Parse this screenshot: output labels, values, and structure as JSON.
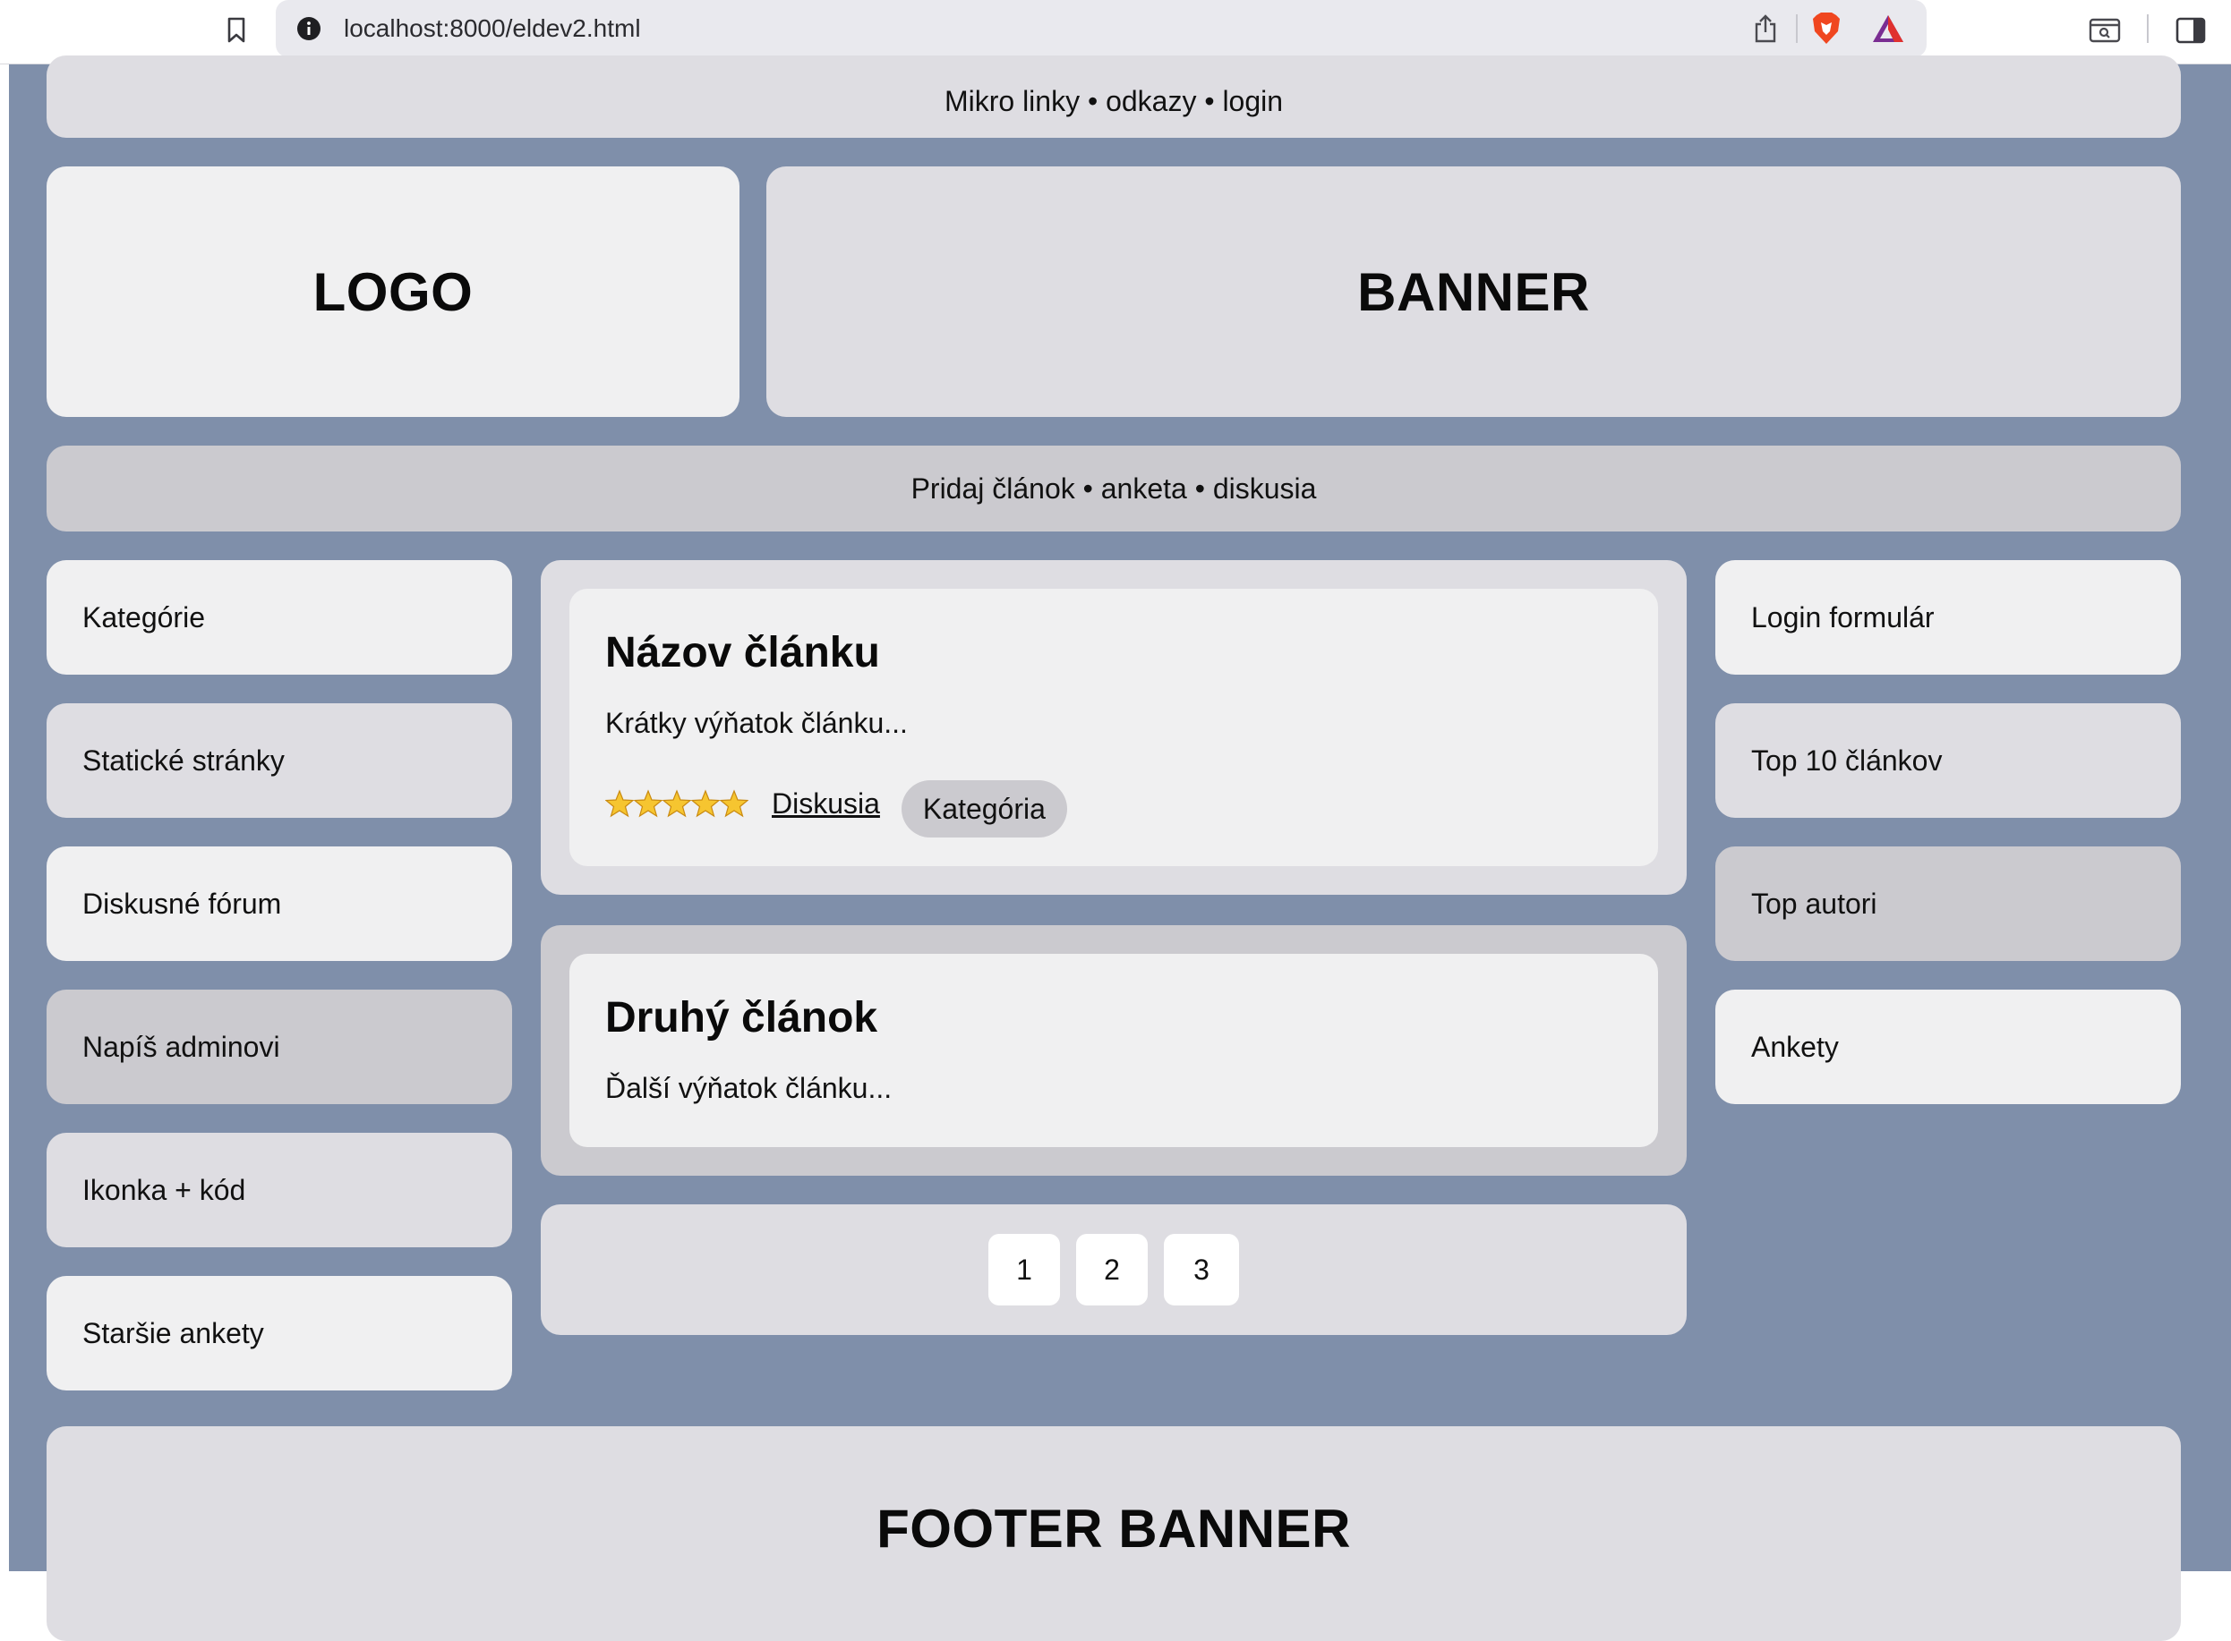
{
  "browser": {
    "url": "localhost:8000/eldev2.html"
  },
  "header": {
    "micro_links": "Mikro linky • odkazy • login",
    "logo": "LOGO",
    "banner": "BANNER",
    "action_bar": "Pridaj článok • anketa • diskusia"
  },
  "left_sidebar": {
    "items": [
      {
        "label": "Kategórie"
      },
      {
        "label": "Statické stránky"
      },
      {
        "label": "Diskusné fórum"
      },
      {
        "label": "Napíš adminovi"
      },
      {
        "label": "Ikonka + kód"
      },
      {
        "label": "Staršie ankety"
      }
    ]
  },
  "articles": [
    {
      "title": "Názov článku",
      "excerpt": "Krátky výňatok článku...",
      "rating_stars": 5,
      "discussion_link": "Diskusia",
      "category_badge": "Kategória"
    },
    {
      "title": "Druhý článok",
      "excerpt": "Ďalší výňatok článku..."
    }
  ],
  "pagination": {
    "pages": [
      "1",
      "2",
      "3"
    ]
  },
  "right_sidebar": {
    "items": [
      {
        "label": "Login formulár"
      },
      {
        "label": "Top 10 článkov"
      },
      {
        "label": "Top autori"
      },
      {
        "label": "Ankety"
      }
    ]
  },
  "footer": {
    "banner": "FOOTER BANNER"
  },
  "colors": {
    "page_background": "#7f8faa",
    "block_light": "#f0f0f1",
    "block_mid": "#dedde2",
    "block_dark": "#cbcacf",
    "star": "#f6c530"
  }
}
